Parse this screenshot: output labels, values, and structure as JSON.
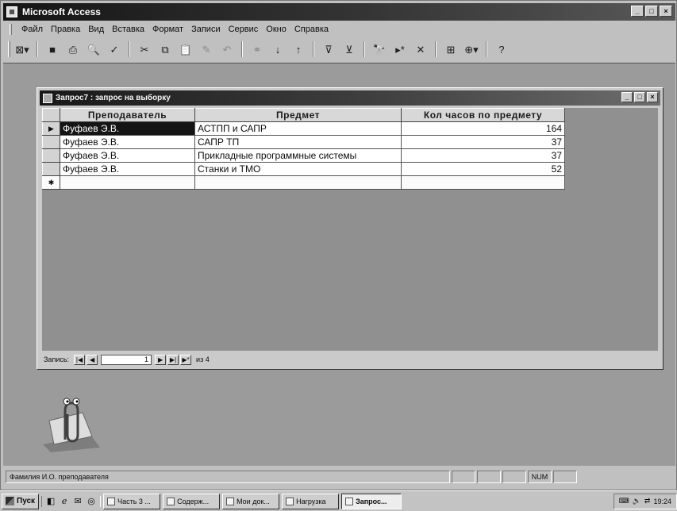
{
  "window": {
    "title": "Microsoft Access",
    "controls": [
      "_",
      "□",
      "×"
    ]
  },
  "menu": {
    "items": [
      "Файл",
      "Правка",
      "Вид",
      "Вставка",
      "Формат",
      "Записи",
      "Сервис",
      "Окно",
      "Справка"
    ]
  },
  "toolbar": {
    "icons": [
      "view-icon",
      "save-icon",
      "print-icon",
      "print-preview-icon",
      "spell-check-icon",
      "cut-icon",
      "copy-icon",
      "paste-icon",
      "format-painter-icon",
      "undo-icon",
      "hyperlink-icon",
      "sort-ascending-icon",
      "sort-descending-icon",
      "filter-by-selection-icon",
      "filter-by-form-icon",
      "find-icon",
      "new-record-icon",
      "delete-record-icon",
      "database-window-icon",
      "new-object-icon",
      "help-icon"
    ]
  },
  "query_window": {
    "title": "Запрос7 : запрос на выборку",
    "columns": [
      "Преподаватель",
      "Предмет",
      "Кол часов по предмету"
    ],
    "rows": [
      {
        "teacher": "Фуфаев Э.В.",
        "subject": "АСТПП и САПР",
        "hours": "164"
      },
      {
        "teacher": "Фуфаев Э.В.",
        "subject": "САПР ТП",
        "hours": "37"
      },
      {
        "teacher": "Фуфаев Э.В.",
        "subject": "Прикладные программные системы",
        "hours": "37"
      },
      {
        "teacher": "Фуфаев Э.В.",
        "subject": "Станки и ТМО",
        "hours": "52"
      }
    ],
    "navigator": {
      "label": "Запись:",
      "current": "1",
      "total": "из 4"
    }
  },
  "statusbar": {
    "text": "Фамилия И.О. преподавателя",
    "indicator": "NUM"
  },
  "taskbar": {
    "start": "Пуск",
    "tasks": [
      "Часть 3 ...",
      "Содерж...",
      "Мои док...",
      "Нагрузка",
      "Запрос..."
    ],
    "clock": "19:24"
  },
  "colors": {
    "titlebar": "#1a1a1a",
    "mdi_background": "#9a9a9a",
    "selection": "#1a1a1a"
  }
}
